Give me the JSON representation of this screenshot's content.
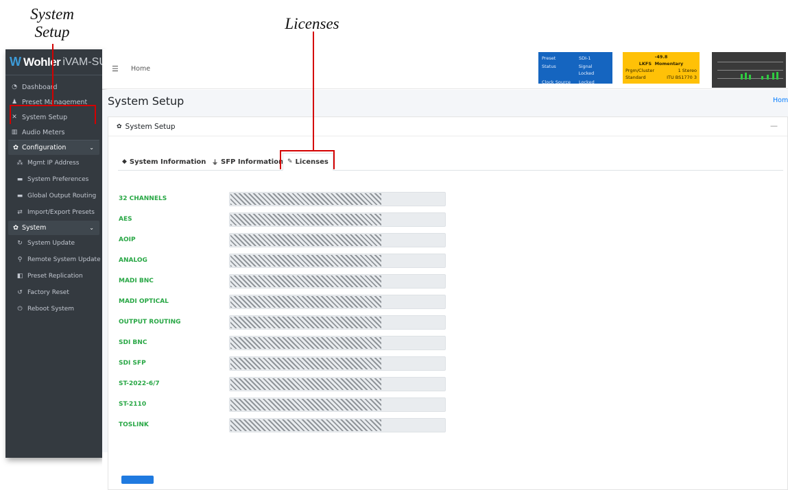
{
  "callouts": {
    "system_setup_line1": "System",
    "system_setup_line2": "Setup",
    "licenses": "Licenses"
  },
  "sidebar": {
    "brand_logo": "Wohler",
    "brand_product": "iVAM-SUM",
    "items": [
      {
        "label": "Dashboard",
        "icon": "dashboard-icon"
      },
      {
        "label": "Preset Management",
        "icon": "users-icon"
      },
      {
        "label": "System Setup",
        "icon": "tools-icon"
      },
      {
        "label": "Audio Meters",
        "icon": "bar-chart-icon"
      }
    ],
    "configuration": {
      "label": "Configuration",
      "items": [
        {
          "label": "Mgmt IP Address"
        },
        {
          "label": "System Preferences"
        },
        {
          "label": "Global Output Routing"
        },
        {
          "label": "Import/Export Presets"
        }
      ]
    },
    "system": {
      "label": "System",
      "items": [
        {
          "label": "System Update"
        },
        {
          "label": "Remote System Update"
        },
        {
          "label": "Preset Replication"
        },
        {
          "label": "Factory Reset"
        },
        {
          "label": "Reboot System"
        }
      ]
    }
  },
  "header": {
    "home": "Home",
    "status_panel": {
      "preset_label": "Preset",
      "preset_value": "SDI-1",
      "status_label": "Status",
      "status_value": "Signal Locked",
      "clock_label": "Clock Source",
      "clock_value": "Locked"
    },
    "loudness_panel": {
      "value": "-49.8",
      "lkfs_label": "LKFS",
      "mode": "Momentary",
      "cluster_label": "Prgm/Cluster",
      "cluster_value": "1  Stereo",
      "standard_label": "Standard",
      "standard_value": "ITU BS1770 3"
    }
  },
  "page": {
    "title": "System Setup",
    "breadcrumb": "Home",
    "card_title": "System Setup",
    "collapse": "—"
  },
  "tabs": [
    {
      "label": "System Information"
    },
    {
      "label": "SFP Information"
    },
    {
      "label": "Licenses"
    }
  ],
  "licenses": [
    {
      "name": "32 CHANNELS",
      "level": 0.7
    },
    {
      "name": "AES",
      "level": 0.7
    },
    {
      "name": "AOIP",
      "level": 0.7
    },
    {
      "name": "ANALOG",
      "level": 0.7
    },
    {
      "name": "MADI BNC",
      "level": 0.7
    },
    {
      "name": "MADI OPTICAL",
      "level": 0.7
    },
    {
      "name": "OUTPUT ROUTING",
      "level": 0.7
    },
    {
      "name": "SDI BNC",
      "level": 0.7
    },
    {
      "name": "SDI SFP",
      "level": 0.7
    },
    {
      "name": "ST-2022-6/7",
      "level": 0.7
    },
    {
      "name": "ST-2110",
      "level": 0.7
    },
    {
      "name": "TOSLINK",
      "level": 0.7
    }
  ]
}
